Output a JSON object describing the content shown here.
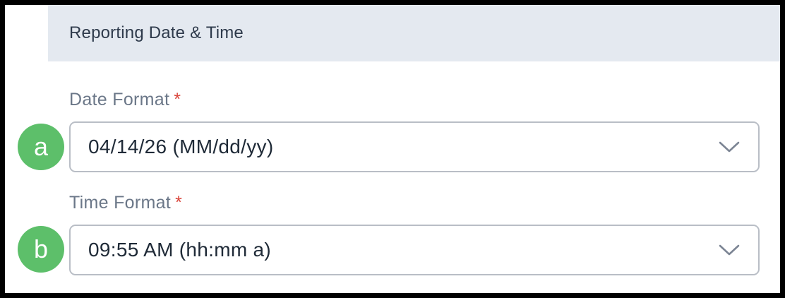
{
  "section": {
    "title": "Reporting Date & Time"
  },
  "fields": [
    {
      "label": "Date Format",
      "required_mark": "*",
      "value": "04/14/26 (MM/dd/yy)",
      "badge": "a"
    },
    {
      "label": "Time Format",
      "required_mark": "*",
      "value": "09:55 AM (hh:mm a)",
      "badge": "b"
    }
  ],
  "colors": {
    "header_bg": "#e4e9f0",
    "label": "#6b7788",
    "required": "#d9443a",
    "badge": "#5dbf6a",
    "border": "#b9bec6"
  },
  "icons": {
    "dropdown": "chevron-down-icon"
  }
}
